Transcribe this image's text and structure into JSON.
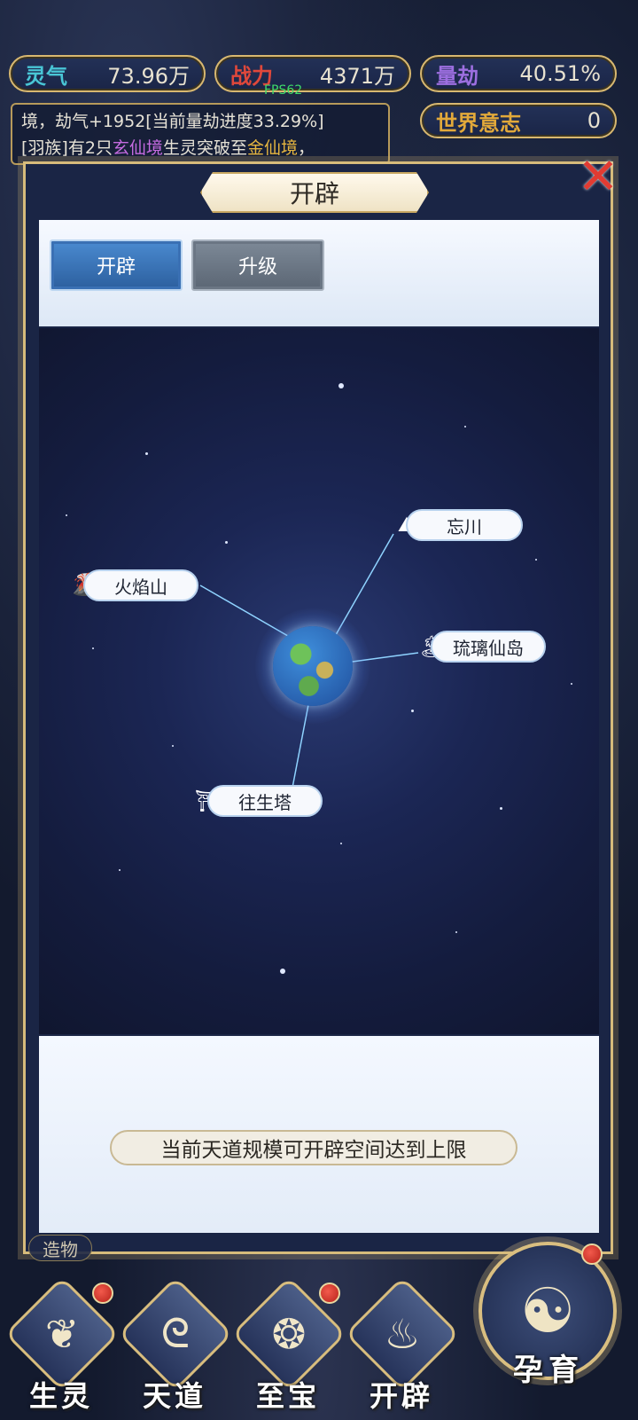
{
  "stats": {
    "lingqi": {
      "label": "灵气",
      "value": "73.96万",
      "color": "#49c6d6"
    },
    "zhanli": {
      "label": "战力",
      "value": "4371万",
      "color": "#e0483b"
    },
    "liangjie": {
      "label": "量劫",
      "value": "40.51%",
      "color": "#9d6fe0"
    },
    "world_will": {
      "label": "世界意志",
      "value": "0",
      "color": "#e2a93a"
    }
  },
  "fps": "FPS62",
  "log": {
    "line1": "境，劫气+1952[当前量劫进度33.29%]",
    "line2_parts": [
      "[羽族]有2只",
      "玄仙境",
      "生灵突破至",
      "金仙境",
      "，"
    ]
  },
  "panel": {
    "title": "开辟",
    "close_icon": "close-x-icon",
    "tabs": [
      {
        "label": "开辟",
        "active": true
      },
      {
        "label": "升级",
        "active": false
      }
    ],
    "locations": [
      {
        "name": "忘川",
        "icon": "mountain-temple-icon"
      },
      {
        "name": "火焰山",
        "icon": "volcano-icon"
      },
      {
        "name": "琉璃仙岛",
        "icon": "island-icon"
      },
      {
        "name": "往生塔",
        "icon": "pagoda-icon"
      }
    ],
    "notice": "当前天道规模可开辟空间达到上限"
  },
  "creation_tag": "造物",
  "nav": [
    {
      "label": "生灵",
      "icon": "creature-icon",
      "badge": true
    },
    {
      "label": "天道",
      "icon": "heaven-swirl-icon",
      "badge": false
    },
    {
      "label": "至宝",
      "icon": "treasure-icon",
      "badge": true
    },
    {
      "label": "开辟",
      "icon": "create-flame-icon",
      "badge": false
    }
  ],
  "breed": {
    "label": "孕育",
    "icon": "embryo-icon",
    "badge": true
  }
}
